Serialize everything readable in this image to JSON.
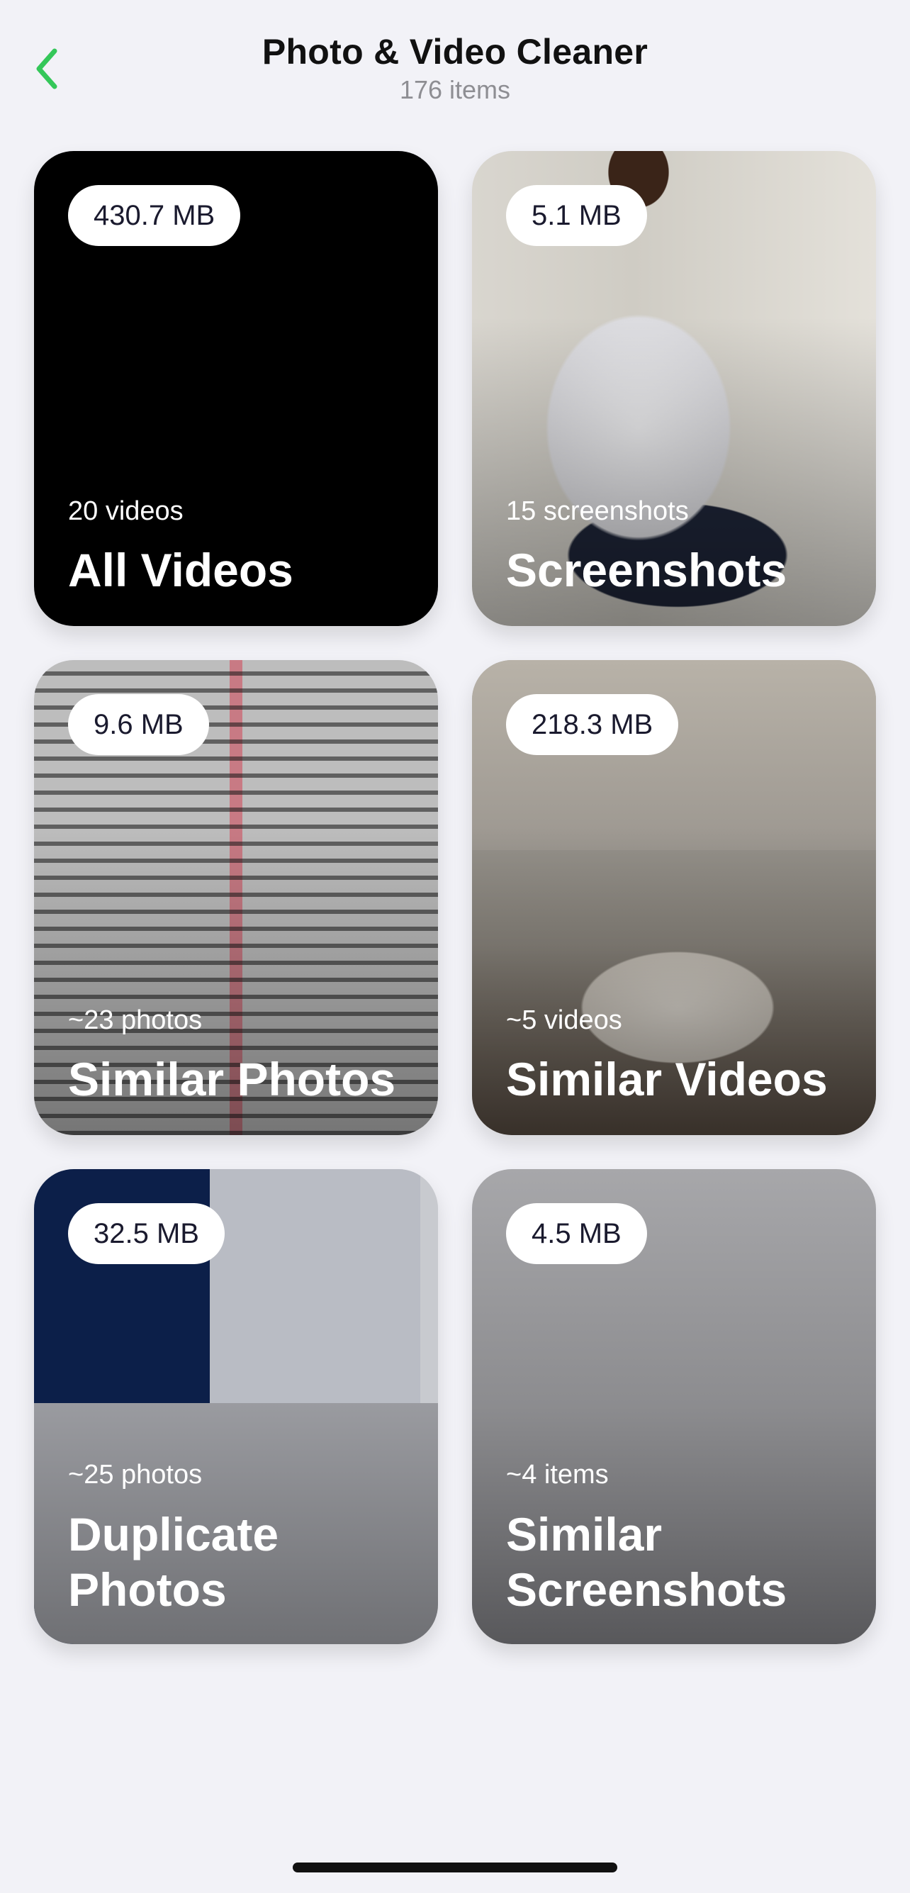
{
  "header": {
    "title": "Photo & Video Cleaner",
    "subtitle": "176 items",
    "back_icon": "chevron-left-icon",
    "accent_color": "#34c759"
  },
  "cards": [
    {
      "size": "430.7 MB",
      "count": "20 videos",
      "label": "All Videos"
    },
    {
      "size": "5.1 MB",
      "count": "15 screenshots",
      "label": "Screenshots"
    },
    {
      "size": "9.6 MB",
      "count": "~23 photos",
      "label": "Similar Photos"
    },
    {
      "size": "218.3 MB",
      "count": "~5 videos",
      "label": "Similar Videos"
    },
    {
      "size": "32.5 MB",
      "count": "~25 photos",
      "label": "Duplicate Photos"
    },
    {
      "size": "4.5 MB",
      "count": "~4 items",
      "label": "Similar Screenshots"
    }
  ]
}
